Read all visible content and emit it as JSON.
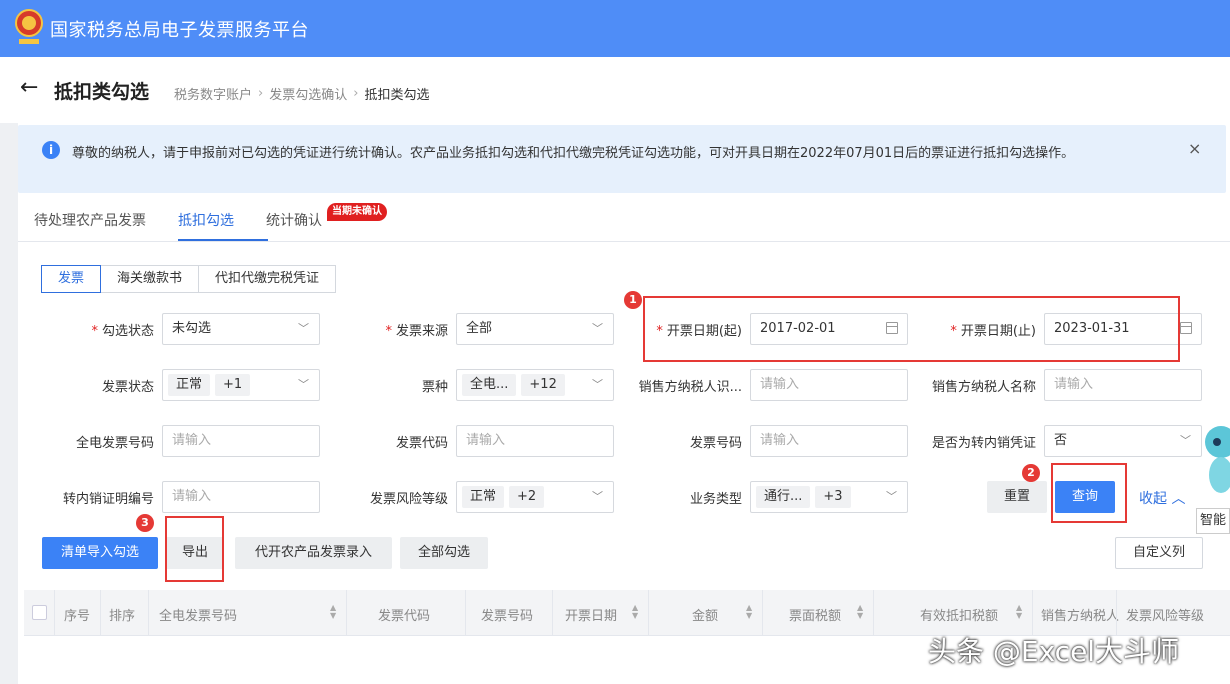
{
  "app": {
    "title": "国家税务总局电子发票服务平台"
  },
  "page": {
    "title": "抵扣类勾选",
    "breadcrumbs": [
      "税务数字账户",
      "发票勾选确认",
      "抵扣类勾选"
    ]
  },
  "notice": {
    "text": "尊敬的纳税人，请于申报前对已勾选的凭证进行统计确认。农产品业务抵扣勾选和代扣代缴完税凭证勾选功能，可对开具日期在2022年07月01日后的票证进行抵扣勾选操作。",
    "close": "×"
  },
  "tabs": [
    {
      "label": "待处理农产品发票"
    },
    {
      "label": "抵扣勾选"
    },
    {
      "label": "统计确认"
    }
  ],
  "badge": "当期未确认",
  "subtabs": [
    {
      "label": "发票"
    },
    {
      "label": "海关缴款书"
    },
    {
      "label": "代扣代缴完税凭证"
    }
  ],
  "filters": {
    "select_status": {
      "label": "勾选状态",
      "value": "未勾选"
    },
    "invoice_source": {
      "label": "发票来源",
      "value": "全部"
    },
    "date_start": {
      "label": "开票日期(起)",
      "value": "2017-02-01"
    },
    "date_end": {
      "label": "开票日期(止)",
      "value": "2023-01-31"
    },
    "invoice_status": {
      "label": "发票状态",
      "chip": "正常",
      "more": "+1"
    },
    "ticket_type": {
      "label": "票种",
      "chip": "全电...",
      "more": "+12"
    },
    "seller_tax_id": {
      "label": "销售方纳税人识...",
      "placeholder": "请输入"
    },
    "seller_name": {
      "label": "销售方纳税人名称",
      "placeholder": "请输入"
    },
    "full_invoice_no": {
      "label": "全电发票号码",
      "placeholder": "请输入"
    },
    "invoice_code": {
      "label": "发票代码",
      "placeholder": "请输入"
    },
    "invoice_no": {
      "label": "发票号码",
      "placeholder": "请输入"
    },
    "transfer_voucher": {
      "label": "是否为转内销凭证",
      "value": "否"
    },
    "transfer_cert_no": {
      "label": "转内销证明编号",
      "placeholder": "请输入"
    },
    "risk_level": {
      "label": "发票风险等级",
      "chip": "正常",
      "more": "+2"
    },
    "business_type": {
      "label": "业务类型",
      "chip": "通行...",
      "more": "+3"
    }
  },
  "buttons": {
    "reset": "重置",
    "query": "查询",
    "collapse": "收起",
    "list_import": "清单导入勾选",
    "export": "导出",
    "agri_entry": "代开农产品发票录入",
    "select_all": "全部勾选",
    "custom_columns": "自定义列"
  },
  "markers": [
    "1",
    "2",
    "3"
  ],
  "table": {
    "columns": [
      "序号",
      "排序",
      "全电发票号码",
      "发票代码",
      "发票号码",
      "开票日期",
      "金额",
      "票面税额",
      "有效抵扣税额",
      "销售方纳税人",
      "发票风险等级"
    ]
  },
  "assistant": {
    "label": "智能"
  },
  "watermark": "头条 @Excel大斗师",
  "colors": {
    "brand": "#4f8df7",
    "primary": "#3b82f6",
    "highlight": "#e53935"
  }
}
